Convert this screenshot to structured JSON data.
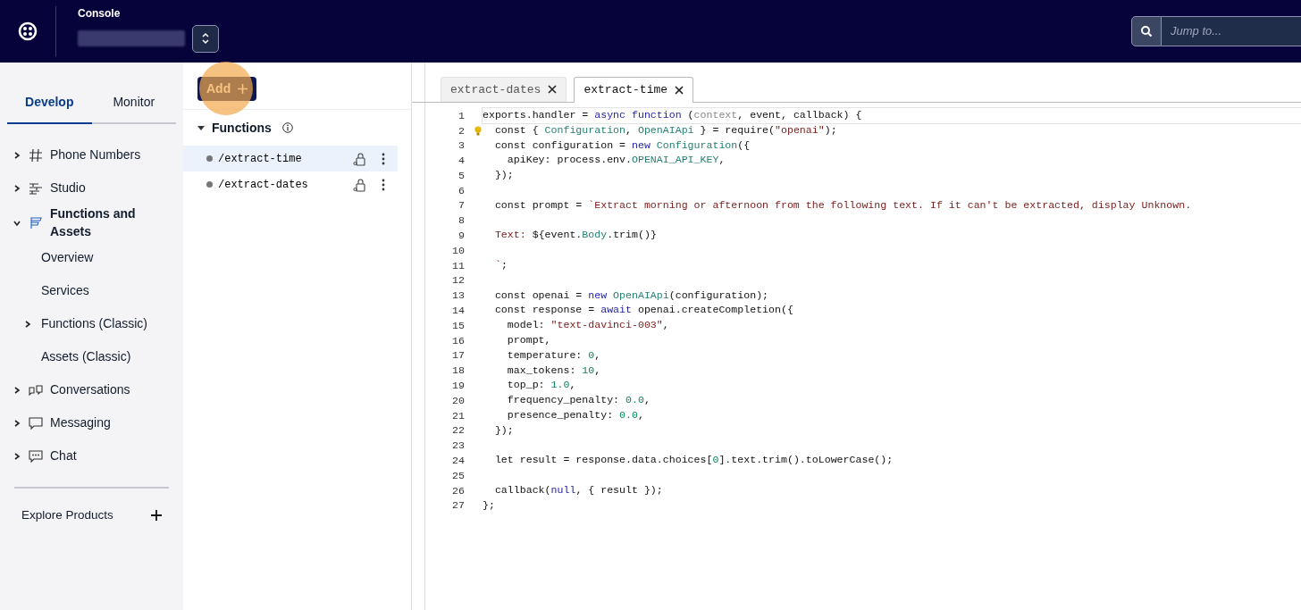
{
  "header": {
    "title": "Console",
    "search": {
      "placeholder": "Jump to..."
    }
  },
  "sidebar": {
    "tabs": [
      {
        "label": "Develop",
        "selected": true
      },
      {
        "label": "Monitor",
        "selected": false
      }
    ],
    "items": [
      {
        "label": "Phone Numbers",
        "expanded": false
      },
      {
        "label": "Studio",
        "expanded": false
      },
      {
        "label": "Functions and Assets",
        "expanded": true,
        "children": [
          {
            "label": "Overview"
          },
          {
            "label": "Services"
          },
          {
            "label": "Functions (Classic)",
            "expanded": false
          },
          {
            "label": "Assets (Classic)"
          }
        ]
      },
      {
        "label": "Conversations",
        "expanded": false
      },
      {
        "label": "Messaging",
        "expanded": false
      },
      {
        "label": "Chat",
        "expanded": false
      }
    ],
    "explore": "Explore Products"
  },
  "functions_panel": {
    "add_button": "Add",
    "section": {
      "title": "Functions",
      "expanded": true
    },
    "items": [
      {
        "path": "/extract-time",
        "selected": true
      },
      {
        "path": "/extract-dates",
        "selected": false
      }
    ]
  },
  "editor": {
    "tabs": [
      {
        "label": "extract-dates",
        "selected": false
      },
      {
        "label": "extract-time",
        "selected": true
      }
    ],
    "lines": [
      {
        "n": "1",
        "current": true,
        "tokens": [
          {
            "t": "exports.handler = ",
            "kind": "plain"
          },
          {
            "t": "async function",
            "kind": "keyword"
          },
          {
            "t": " (",
            "kind": "plain"
          },
          {
            "t": "context",
            "kind": "dim"
          },
          {
            "t": ", event, callback) {",
            "kind": "plain"
          }
        ]
      },
      {
        "n": "2",
        "lightbulb": true,
        "tokens": [
          {
            "t": "  const { ",
            "kind": "plain"
          },
          {
            "t": "Configuration",
            "kind": "type"
          },
          {
            "t": ", ",
            "kind": "plain"
          },
          {
            "t": "OpenAIApi",
            "kind": "type"
          },
          {
            "t": " } = require(",
            "kind": "plain"
          },
          {
            "t": "\"openai\"",
            "kind": "string"
          },
          {
            "t": ");",
            "kind": "plain"
          }
        ]
      },
      {
        "n": "3",
        "tokens": [
          {
            "t": "  const configuration = ",
            "kind": "plain"
          },
          {
            "t": "new",
            "kind": "keyword"
          },
          {
            "t": " Configuration",
            "kind": "type"
          },
          {
            "t": "({",
            "kind": "plain"
          }
        ]
      },
      {
        "n": "4",
        "tokens": [
          {
            "t": "    apiKey: process.env.",
            "kind": "plain"
          },
          {
            "t": "OPENAI_API_KEY",
            "kind": "type"
          },
          {
            "t": ",",
            "kind": "plain"
          }
        ]
      },
      {
        "n": "5",
        "tokens": [
          {
            "t": "  });",
            "kind": "plain"
          }
        ]
      },
      {
        "n": "6"
      },
      {
        "n": "7",
        "tokens": [
          {
            "t": "  const prompt = ",
            "kind": "plain"
          },
          {
            "t": "`Extract morning or afternoon from the following text. If it can't be extracted, display Unknown.",
            "kind": "string"
          }
        ]
      },
      {
        "n": "8"
      },
      {
        "n": "9",
        "tokens": [
          {
            "t": "  Text: ",
            "kind": "string"
          },
          {
            "t": "${event.",
            "kind": "plain"
          },
          {
            "t": "Body",
            "kind": "type"
          },
          {
            "t": ".trim()}",
            "kind": "plain"
          }
        ]
      },
      {
        "n": "10"
      },
      {
        "n": "11",
        "tokens": [
          {
            "t": "  `",
            "kind": "string"
          },
          {
            "t": ";",
            "kind": "plain"
          }
        ]
      },
      {
        "n": "12"
      },
      {
        "n": "13",
        "tokens": [
          {
            "t": "  const openai = ",
            "kind": "plain"
          },
          {
            "t": "new",
            "kind": "keyword"
          },
          {
            "t": " OpenAIApi",
            "kind": "type"
          },
          {
            "t": "(configuration);",
            "kind": "plain"
          }
        ]
      },
      {
        "n": "14",
        "tokens": [
          {
            "t": "  const response = ",
            "kind": "plain"
          },
          {
            "t": "await",
            "kind": "keyword"
          },
          {
            "t": " openai.createCompletion({",
            "kind": "plain"
          }
        ]
      },
      {
        "n": "15",
        "tokens": [
          {
            "t": "    model: ",
            "kind": "plain"
          },
          {
            "t": "\"text-davinci-003\"",
            "kind": "string"
          },
          {
            "t": ",",
            "kind": "plain"
          }
        ]
      },
      {
        "n": "16",
        "tokens": [
          {
            "t": "    prompt,",
            "kind": "plain"
          }
        ]
      },
      {
        "n": "17",
        "tokens": [
          {
            "t": "    temperature: ",
            "kind": "plain"
          },
          {
            "t": "0",
            "kind": "number"
          },
          {
            "t": ",",
            "kind": "plain"
          }
        ]
      },
      {
        "n": "18",
        "tokens": [
          {
            "t": "    max_tokens: ",
            "kind": "plain"
          },
          {
            "t": "10",
            "kind": "number"
          },
          {
            "t": ",",
            "kind": "plain"
          }
        ]
      },
      {
        "n": "19",
        "tokens": [
          {
            "t": "    top_p: ",
            "kind": "plain"
          },
          {
            "t": "1.0",
            "kind": "number"
          },
          {
            "t": ",",
            "kind": "plain"
          }
        ]
      },
      {
        "n": "20",
        "tokens": [
          {
            "t": "    frequency_penalty: ",
            "kind": "plain"
          },
          {
            "t": "0.0",
            "kind": "number"
          },
          {
            "t": ",",
            "kind": "plain"
          }
        ]
      },
      {
        "n": "21",
        "tokens": [
          {
            "t": "    presence_penalty: ",
            "kind": "plain"
          },
          {
            "t": "0.0",
            "kind": "number"
          },
          {
            "t": ",",
            "kind": "plain"
          }
        ]
      },
      {
        "n": "22",
        "tokens": [
          {
            "t": "  });",
            "kind": "plain"
          }
        ]
      },
      {
        "n": "23"
      },
      {
        "n": "24",
        "tokens": [
          {
            "t": "  let result = response.data.choices[",
            "kind": "plain"
          },
          {
            "t": "0",
            "kind": "number"
          },
          {
            "t": "].text.trim().toLowerCase();",
            "kind": "plain"
          }
        ]
      },
      {
        "n": "25"
      },
      {
        "n": "26",
        "tokens": [
          {
            "t": "  callback(",
            "kind": "plain"
          },
          {
            "t": "null",
            "kind": "keyword"
          },
          {
            "t": ", { result });",
            "kind": "plain"
          }
        ]
      },
      {
        "n": "27",
        "tokens": [
          {
            "t": "};",
            "kind": "plain"
          }
        ]
      }
    ]
  }
}
